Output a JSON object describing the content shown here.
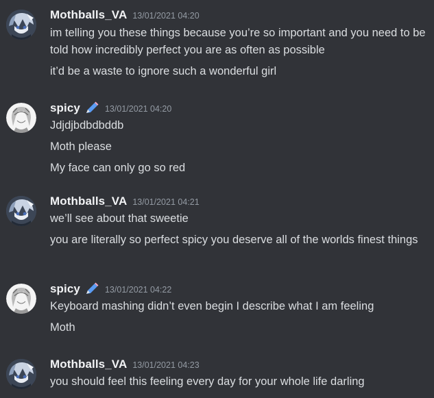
{
  "messages": [
    {
      "username": "Mothballs_VA",
      "avatar_icon": "anime-character-avatar-icon",
      "timestamp": "13/01/2021 04:20",
      "lines": [
        "im telling you these things because you’re so important and you need to be told how incredibly perfect you are as often as possible",
        "it’d be a waste to ignore such a wonderful girl"
      ]
    },
    {
      "username": "spicy",
      "avatar_icon": "sketch-character-avatar-icon",
      "badge_icon": "pencil-icon",
      "timestamp": "13/01/2021 04:20",
      "lines": [
        "Jdjdjbdbdbddb",
        "Moth please",
        "My face can only go so red"
      ]
    },
    {
      "username": "Mothballs_VA",
      "avatar_icon": "anime-character-avatar-icon",
      "timestamp": "13/01/2021 04:21",
      "lines": [
        "we’ll see about that sweetie",
        "you are literally so perfect spicy you deserve all of the worlds finest things"
      ]
    },
    {
      "username": "spicy",
      "avatar_icon": "sketch-character-avatar-icon",
      "badge_icon": "pencil-icon",
      "timestamp": "13/01/2021 04:22",
      "lines": [
        "Keyboard mashing didn’t even begin I describe what I am feeling",
        "Moth"
      ]
    },
    {
      "username": "Mothballs_VA",
      "avatar_icon": "anime-character-avatar-icon",
      "timestamp": "13/01/2021 04:23",
      "lines": [
        "you should feel this feeling every day for your whole life darling"
      ]
    }
  ],
  "colors": {
    "background": "#313338",
    "username": "#f2f3f5",
    "message_text": "#dbdee1",
    "timestamp": "#949ba4",
    "badge_blue": "#5b9cf3"
  }
}
